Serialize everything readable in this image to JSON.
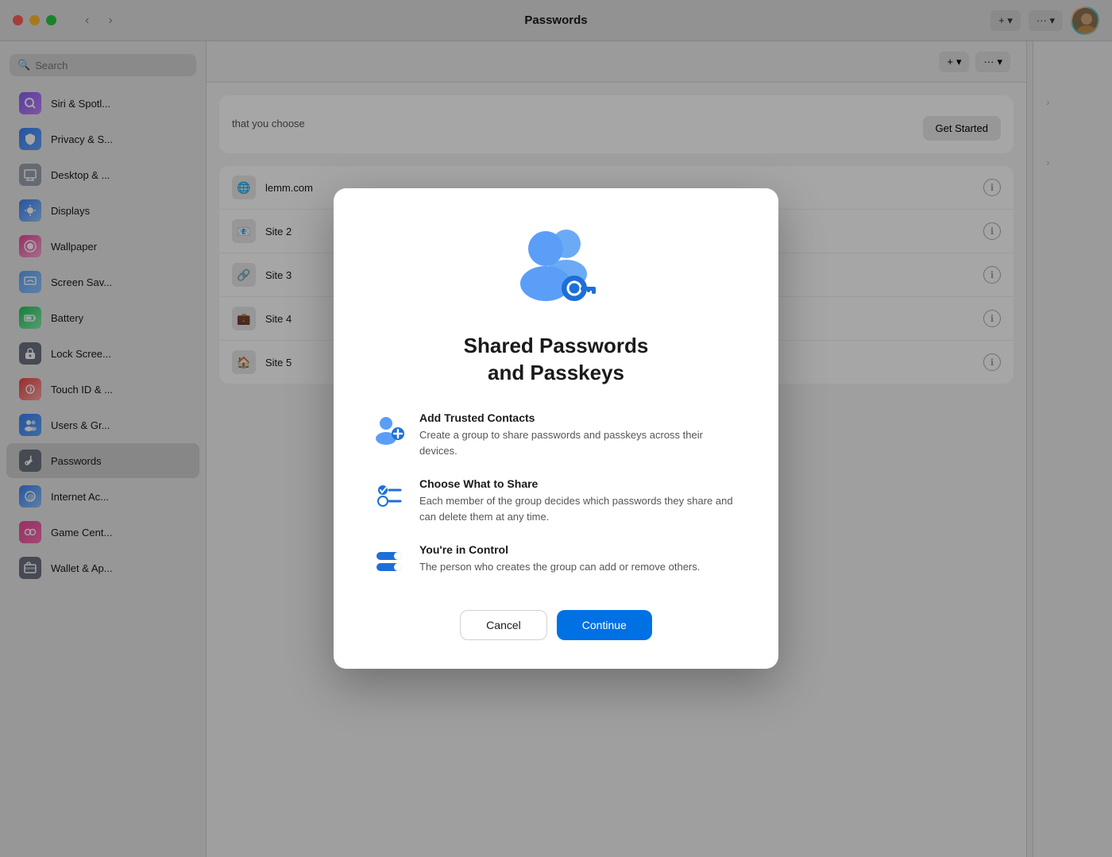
{
  "window": {
    "title": "Passwords",
    "controls": {
      "close": "close",
      "minimize": "minimize",
      "maximize": "maximize"
    }
  },
  "header": {
    "add_label": "+ ▾",
    "more_label": "··· ▾"
  },
  "search": {
    "placeholder": "Search"
  },
  "sidebar": {
    "items": [
      {
        "id": "siri-spotlight",
        "label": "Siri & Spotl...",
        "icon_color": "#a855f7",
        "icon": "🔍"
      },
      {
        "id": "privacy-security",
        "label": "Privacy & S...",
        "icon_color": "#3b82f6",
        "icon": "✋"
      },
      {
        "id": "desktop-screensaver",
        "label": "Desktop & ...",
        "icon_color": "#6b7280",
        "icon": "🖥"
      },
      {
        "id": "displays",
        "label": "Displays",
        "icon_color": "#3b82f6",
        "icon": "☀️"
      },
      {
        "id": "wallpaper",
        "label": "Wallpaper",
        "icon_color": "#ec4899",
        "icon": "🌸"
      },
      {
        "id": "screen-saver",
        "label": "Screen Sav...",
        "icon_color": "#3b82f6",
        "icon": "🌙"
      },
      {
        "id": "battery",
        "label": "Battery",
        "icon_color": "#22c55e",
        "icon": "🔋"
      },
      {
        "id": "lock-screen",
        "label": "Lock Scree...",
        "icon_color": "#6b7280",
        "icon": "⌨️"
      },
      {
        "id": "touch-id",
        "label": "Touch ID & ...",
        "icon_color": "#ef4444",
        "icon": "👆"
      },
      {
        "id": "users-groups",
        "label": "Users & Gr...",
        "icon_color": "#3b82f6",
        "icon": "👥"
      },
      {
        "id": "passwords",
        "label": "Passwords",
        "icon_color": "#6b7280",
        "icon": "🔑",
        "active": true
      },
      {
        "id": "internet-accounts",
        "label": "Internet Ac...",
        "icon_color": "#3b82f6",
        "icon": "@"
      },
      {
        "id": "game-center",
        "label": "Game Cent...",
        "icon_color": "#ec4899",
        "icon": "🎮"
      },
      {
        "id": "wallet-apple-pay",
        "label": "Wallet & Ap...",
        "icon_color": "#6b7280",
        "icon": "💳"
      }
    ]
  },
  "modal": {
    "title_line1": "Shared Passwords",
    "title_line2": "and Passkeys",
    "features": [
      {
        "id": "add-trusted",
        "title": "Add Trusted Contacts",
        "desc": "Create a group to share passwords and passkeys across their devices.",
        "icon_type": "add-person"
      },
      {
        "id": "choose-share",
        "title": "Choose What to Share",
        "desc": "Each member of the group decides which passwords they share and can delete them at any time.",
        "icon_type": "checklist"
      },
      {
        "id": "in-control",
        "title": "You're in Control",
        "desc": "The person who creates the group can add or remove others.",
        "icon_type": "toggle"
      }
    ],
    "cancel_label": "Cancel",
    "continue_label": "Continue"
  },
  "passwords_content": {
    "shared_section": {
      "desc": "that you choose",
      "get_started_label": "Get Started"
    },
    "info_buttons": 5
  }
}
